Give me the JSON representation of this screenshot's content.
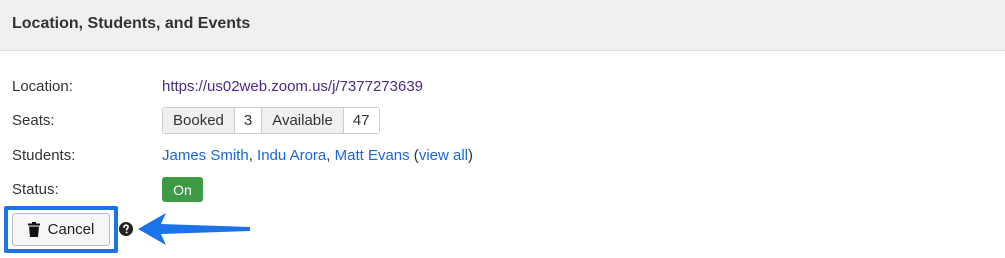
{
  "panel": {
    "title": "Location, Students, and Events"
  },
  "location": {
    "label": "Location:",
    "url": "https://us02web.zoom.us/j/7377273639"
  },
  "seats": {
    "label": "Seats:",
    "booked_label": "Booked",
    "booked_count": "3",
    "available_label": "Available",
    "available_count": "47"
  },
  "students": {
    "label": "Students:",
    "names": [
      "James Smith",
      "Indu Arora",
      "Matt Evans"
    ],
    "separator": ", ",
    "open_paren": " (",
    "view_all": "view all",
    "close_paren": ")"
  },
  "status": {
    "label": "Status:",
    "value": "On",
    "color": "#3e9a45"
  },
  "actions": {
    "cancel_label": "Cancel",
    "cancel_icon": "trash-icon",
    "help_icon": "question-circle-icon"
  },
  "annotation": {
    "highlight_color": "#1a73e8",
    "pointer": "arrow-left"
  }
}
